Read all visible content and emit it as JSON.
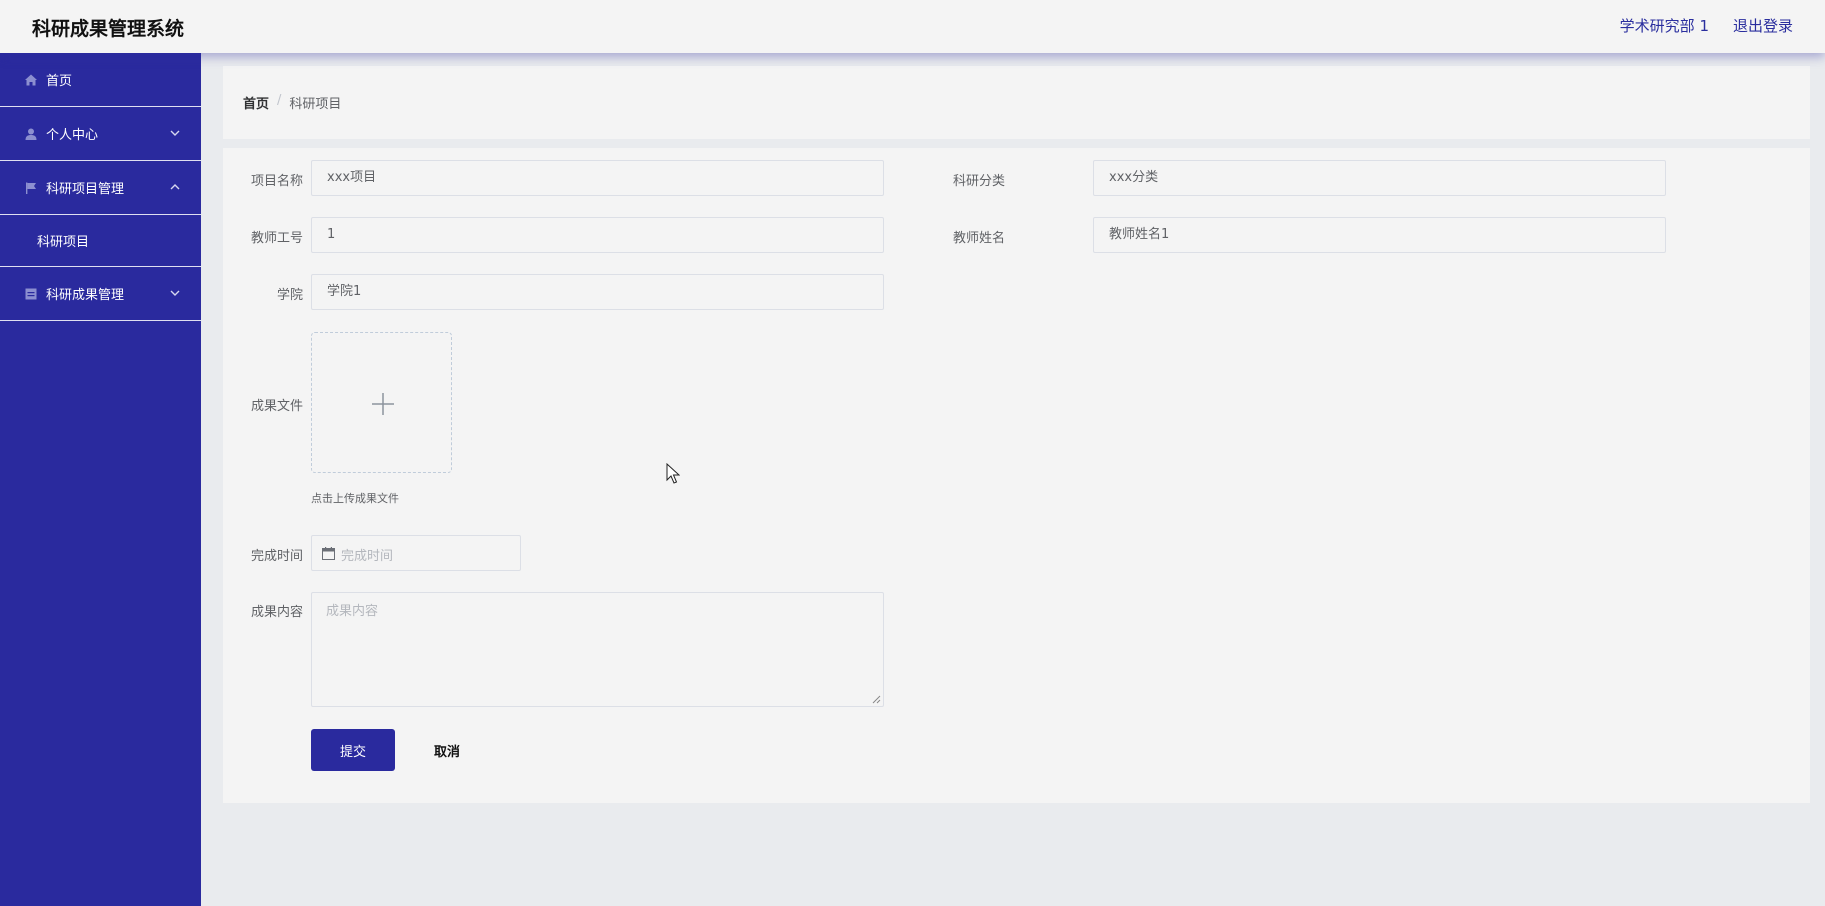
{
  "header": {
    "title": "科研成果管理系统",
    "user": "学术研究部 1",
    "logout": "退出登录"
  },
  "sidebar": {
    "items": [
      {
        "label": "首页",
        "icon": "home-icon"
      },
      {
        "label": "个人中心",
        "icon": "user-icon"
      },
      {
        "label": "科研项目管理",
        "icon": "flag-icon",
        "expanded": true,
        "children": [
          {
            "label": "科研项目"
          }
        ]
      },
      {
        "label": "科研成果管理",
        "icon": "document-icon"
      }
    ]
  },
  "breadcrumb": {
    "home": "首页",
    "separator": "/",
    "current": "科研项目"
  },
  "form": {
    "project_name": {
      "label": "项目名称",
      "value": "xxx项目"
    },
    "category": {
      "label": "科研分类",
      "value": "xxx分类"
    },
    "teacher_id": {
      "label": "教师工号",
      "value": "1"
    },
    "teacher_name": {
      "label": "教师姓名",
      "value": "教师姓名1"
    },
    "college": {
      "label": "学院",
      "value": "学院1"
    },
    "file": {
      "label": "成果文件",
      "hint": "点击上传成果文件"
    },
    "finish_time": {
      "label": "完成时间",
      "placeholder": "完成时间"
    },
    "content": {
      "label": "成果内容",
      "placeholder": "成果内容"
    },
    "submit": "提交",
    "cancel": "取消"
  },
  "colors": {
    "primary": "#2a2a9e",
    "panel": "#f4f4f4",
    "background": "#e9ebee"
  }
}
